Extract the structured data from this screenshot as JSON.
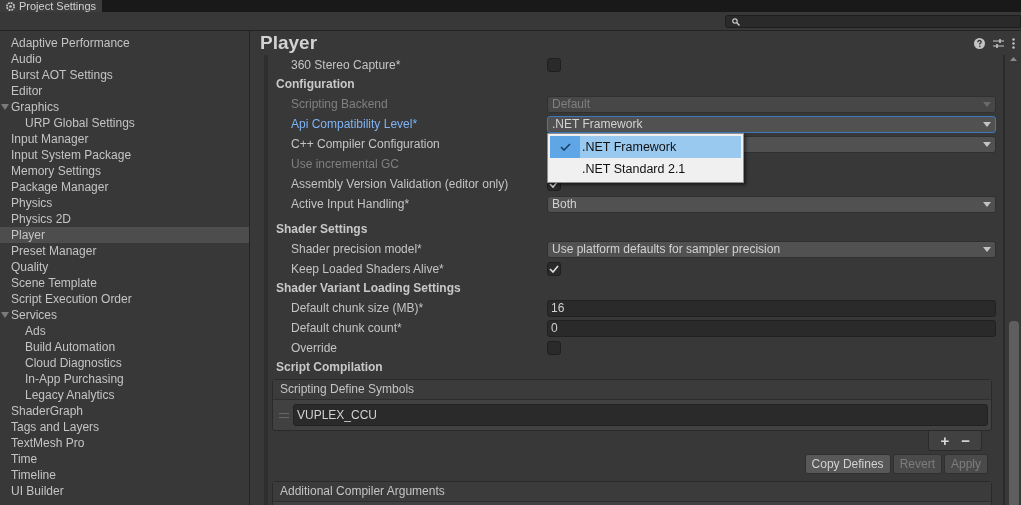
{
  "window": {
    "title": "Project Settings"
  },
  "sidebar": {
    "items": [
      {
        "label": "Adaptive Performance",
        "selected": false
      },
      {
        "label": "Audio",
        "selected": false
      },
      {
        "label": "Burst AOT Settings",
        "selected": false
      },
      {
        "label": "Editor",
        "selected": false
      },
      {
        "label": "Graphics",
        "selected": false,
        "expanded": true,
        "children": [
          {
            "label": "URP Global Settings",
            "selected": false
          }
        ]
      },
      {
        "label": "Input Manager",
        "selected": false
      },
      {
        "label": "Input System Package",
        "selected": false
      },
      {
        "label": "Memory Settings",
        "selected": false
      },
      {
        "label": "Package Manager",
        "selected": false
      },
      {
        "label": "Physics",
        "selected": false
      },
      {
        "label": "Physics 2D",
        "selected": false
      },
      {
        "label": "Player",
        "selected": true
      },
      {
        "label": "Preset Manager",
        "selected": false
      },
      {
        "label": "Quality",
        "selected": false
      },
      {
        "label": "Scene Template",
        "selected": false
      },
      {
        "label": "Script Execution Order",
        "selected": false
      },
      {
        "label": "Services",
        "selected": false,
        "expanded": true,
        "children": [
          {
            "label": "Ads",
            "selected": false
          },
          {
            "label": "Build Automation",
            "selected": false
          },
          {
            "label": "Cloud Diagnostics",
            "selected": false
          },
          {
            "label": "In-App Purchasing",
            "selected": false
          },
          {
            "label": "Legacy Analytics",
            "selected": false
          }
        ]
      },
      {
        "label": "ShaderGraph",
        "selected": false
      },
      {
        "label": "Tags and Layers",
        "selected": false
      },
      {
        "label": "TextMesh Pro",
        "selected": false
      },
      {
        "label": "Time",
        "selected": false
      },
      {
        "label": "Timeline",
        "selected": false
      },
      {
        "label": "UI Builder",
        "selected": false
      }
    ]
  },
  "inspector": {
    "title": "Player",
    "rows": [
      {
        "kind": "checkbox",
        "label": "360 Stereo Capture*",
        "checked": false
      },
      {
        "kind": "header",
        "label": "Configuration"
      },
      {
        "kind": "dropdown",
        "label": "Scripting Backend",
        "value": "Default",
        "disabled": true
      },
      {
        "kind": "dropdown",
        "label": "Api Compatibility Level*",
        "value": ".NET Framework",
        "disabled": false,
        "focused": true,
        "popup": [
          {
            "label": ".NET Framework",
            "selected": true
          },
          {
            "label": ".NET Standard 2.1",
            "selected": false
          }
        ]
      },
      {
        "kind": "dropdown",
        "label": "C++ Compiler Configuration",
        "disabled": false
      },
      {
        "kind": "plain",
        "label": "Use incremental GC",
        "disabled": true
      },
      {
        "kind": "checkbox",
        "label": "Assembly Version Validation (editor only)",
        "checked": true
      },
      {
        "kind": "dropdown",
        "label": "Active Input Handling*",
        "value": "Both",
        "disabled": false
      },
      {
        "kind": "header",
        "label": "Shader Settings"
      },
      {
        "kind": "dropdown",
        "label": "Shader precision model*",
        "value": "Use platform defaults for sampler precision",
        "disabled": false
      },
      {
        "kind": "checkbox",
        "label": "Keep Loaded Shaders Alive*",
        "checked": true
      },
      {
        "kind": "header",
        "label": "Shader Variant Loading Settings"
      },
      {
        "kind": "field",
        "label": "Default chunk size (MB)*",
        "value": "16"
      },
      {
        "kind": "field",
        "label": "Default chunk count*",
        "value": "0"
      },
      {
        "kind": "checkbox",
        "label": "Override",
        "checked": false
      },
      {
        "kind": "header",
        "label": "Script Compilation"
      }
    ],
    "define_symbols": {
      "title": "Scripting Define Symbols",
      "items": [
        "VUPLEX_CCU"
      ],
      "add": "+",
      "remove": "−"
    },
    "buttons": [
      {
        "label": "Copy Defines",
        "disabled": false
      },
      {
        "label": "Revert",
        "disabled": true
      },
      {
        "label": "Apply",
        "disabled": true
      }
    ],
    "compiler_arguments": {
      "title": "Additional Compiler Arguments"
    }
  }
}
